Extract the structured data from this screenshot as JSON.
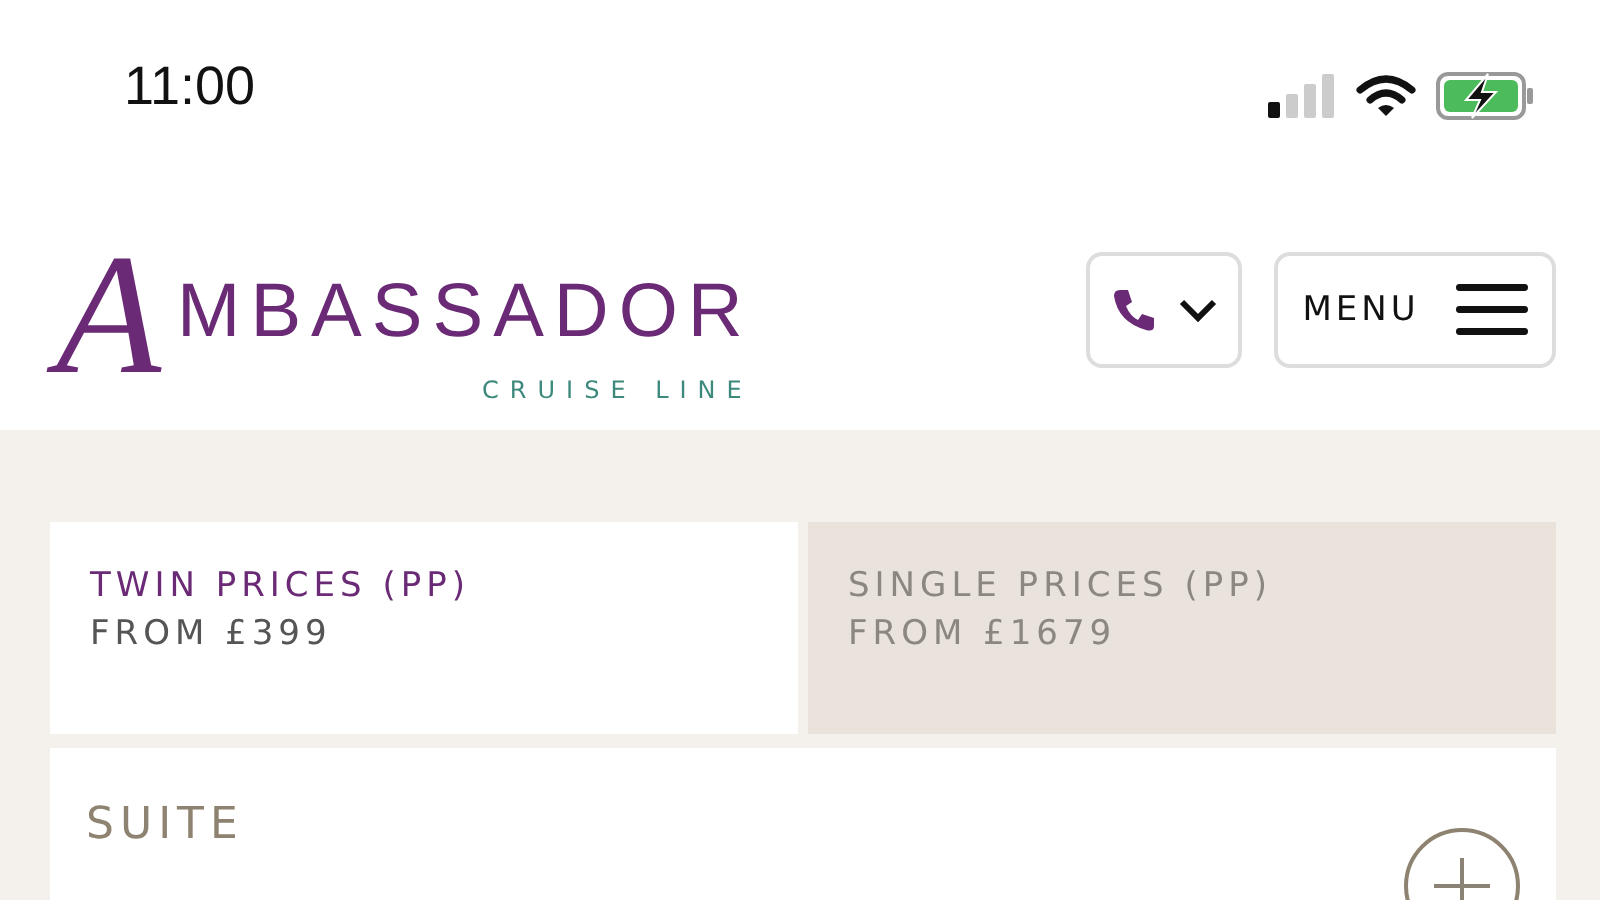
{
  "status_bar": {
    "time": "11:00"
  },
  "header": {
    "logo": {
      "initial": "A",
      "rest": "MBASSADOR",
      "tagline": "CRUISE LINE"
    },
    "menu_button": "MENU"
  },
  "price_tabs": [
    {
      "title": "TWIN PRICES (PP)",
      "subtitle": "FROM £399",
      "selected": true
    },
    {
      "title": "SINGLE PRICES (PP)",
      "subtitle": "FROM £1679",
      "selected": false
    }
  ],
  "cabin_card": {
    "title": "SUITE",
    "expanded": false
  }
}
